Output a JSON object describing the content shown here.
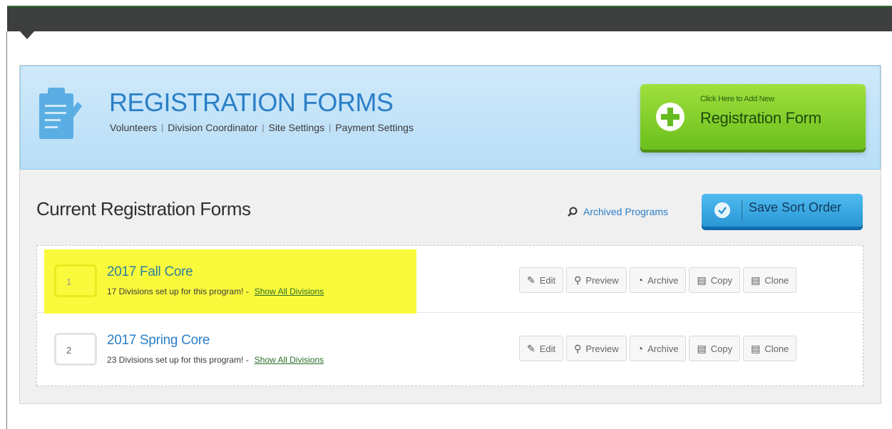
{
  "header": {
    "title": "REGISTRATION FORMS",
    "nav": [
      "Volunteers",
      "Division Coordinator",
      "Site Settings",
      "Payment Settings"
    ],
    "add_button": {
      "small": "Click Here to Add New",
      "big": "Registration Form"
    }
  },
  "section": {
    "title": "Current Registration Forms",
    "archived_link": "Archived Programs",
    "save_button": "Save Sort Order"
  },
  "programs": [
    {
      "order": "1",
      "title": "2017 Fall Core",
      "subtitle": "17 Divisions set up for this program! -",
      "show_link": "Show All Divisions",
      "highlighted": true
    },
    {
      "order": "2",
      "title": "2017 Spring Core",
      "subtitle": "23 Divisions set up for this program! -",
      "show_link": "Show All Divisions",
      "highlighted": false
    }
  ],
  "actions": [
    "Edit",
    "Preview",
    "Archive",
    "Copy",
    "Clone"
  ],
  "colors": {
    "accent": "#2b7fc7",
    "add_green": "#6bbf1c",
    "save_blue": "#2a97d6",
    "highlight": "#fafa3c"
  }
}
